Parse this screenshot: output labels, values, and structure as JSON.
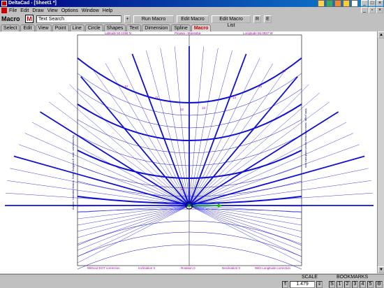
{
  "window": {
    "title": "DeltaCad - [Sheet1 *]"
  },
  "menu": [
    "File",
    "Edit",
    "Draw",
    "View",
    "Options",
    "Window",
    "Help"
  ],
  "mode": {
    "label": "Macro",
    "icon": "M"
  },
  "search": {
    "value": "Text Search"
  },
  "toolbar": {
    "dropdown": "+",
    "run_macro": "Run Macro",
    "edit_macro": "Edit Macro",
    "edit_macro_list": "Edit Macro List",
    "r": "R",
    "e": "E"
  },
  "tabs": [
    "Select",
    "Edit",
    "View",
    "Point",
    "Line",
    "Circle",
    "Shapes",
    "Text",
    "Dimension",
    "Spline",
    "Macro"
  ],
  "drawing": {
    "top_labels": [
      "Latitude 50.1498 N",
      "Pinawa - Manitoba",
      "Longitude 95.0937 W"
    ],
    "bottom_labels": [
      "Without EOT correction",
      "Inclination 0",
      "Rotation 0",
      "Declination 0",
      "With Longitude correction"
    ],
    "left_vertical": "Author: Valentin Hristov, Sofia, Bulgaria   E-mail: valhristov.bg",
    "right_vertical": "Web page: www.valhristov.tripod.com/index.htm",
    "hour_labels": [
      "12",
      "12",
      "13",
      "14",
      "15",
      "16",
      "11",
      "10"
    ]
  },
  "status": {
    "scale_label": "SCALE",
    "scale_value": "1.479",
    "bookmarks_label": "BOOKMARKS",
    "bookmarks": [
      "S",
      "1",
      "2",
      "3",
      "4",
      "5"
    ]
  }
}
